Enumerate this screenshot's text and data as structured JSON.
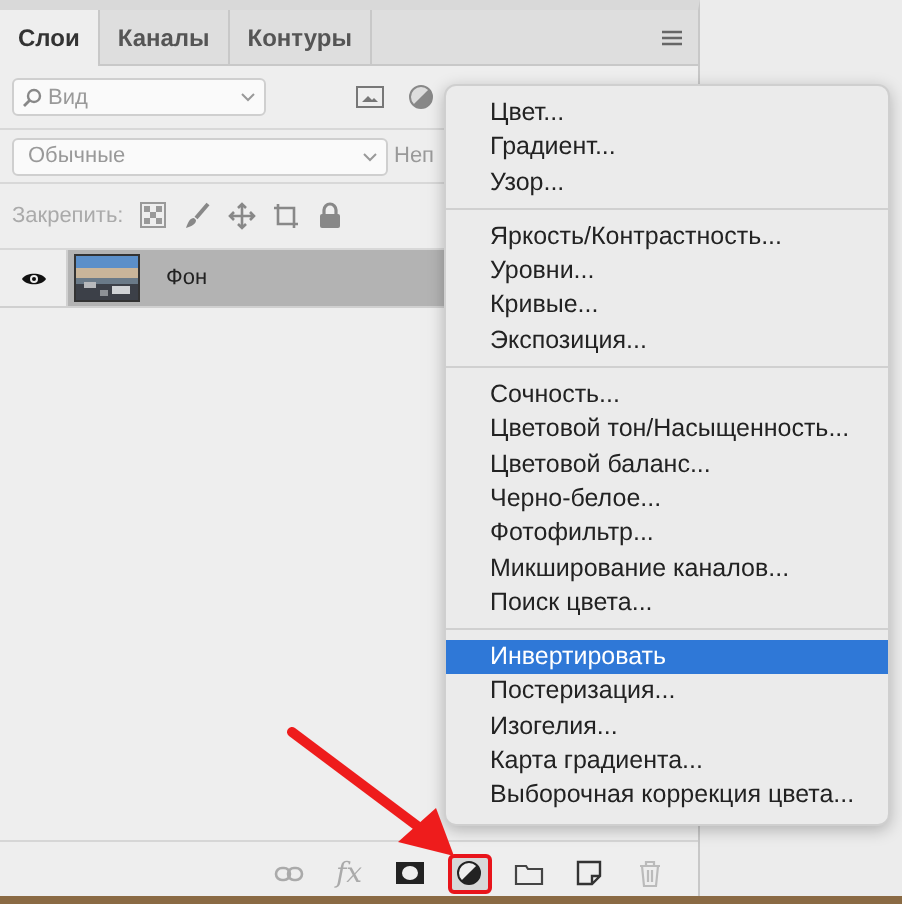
{
  "tabs": [
    {
      "label": "Слои",
      "selected": true
    },
    {
      "label": "Каналы",
      "selected": false
    },
    {
      "label": "Контуры",
      "selected": false
    }
  ],
  "filter": {
    "value": "Вид"
  },
  "blend_mode": {
    "value": "Обычные"
  },
  "opacity_label": "Неп",
  "lock_label": "Закрепить:",
  "layers": [
    {
      "name": "Фон",
      "visible": true,
      "selected": true
    }
  ],
  "menu": {
    "groups": [
      [
        {
          "label": "Цвет...",
          "selected": false
        },
        {
          "label": "Градиент...",
          "selected": false
        },
        {
          "label": "Узор...",
          "selected": false
        }
      ],
      [
        {
          "label": "Яркость/Контрастность...",
          "selected": false
        },
        {
          "label": "Уровни...",
          "selected": false
        },
        {
          "label": "Кривые...",
          "selected": false
        },
        {
          "label": "Экспозиция...",
          "selected": false
        }
      ],
      [
        {
          "label": "Сочность...",
          "selected": false
        },
        {
          "label": "Цветовой тон/Насыщенность...",
          "selected": false
        },
        {
          "label": "Цветовой баланс...",
          "selected": false
        },
        {
          "label": "Черно-белое...",
          "selected": false
        },
        {
          "label": "Фотофильтр...",
          "selected": false
        },
        {
          "label": "Микширование каналов...",
          "selected": false
        },
        {
          "label": "Поиск цвета...",
          "selected": false
        }
      ],
      [
        {
          "label": "Инвертировать",
          "selected": true
        },
        {
          "label": "Постеризация...",
          "selected": false
        },
        {
          "label": "Изогелия...",
          "selected": false
        },
        {
          "label": "Карта градиента...",
          "selected": false
        },
        {
          "label": "Выборочная коррекция цвета...",
          "selected": false
        }
      ]
    ]
  },
  "toolbar": [
    {
      "kind": "link",
      "highlighted": false
    },
    {
      "kind": "fx",
      "label": "fx",
      "highlighted": false
    },
    {
      "kind": "mask",
      "highlighted": false
    },
    {
      "kind": "adjustment",
      "highlighted": true
    },
    {
      "kind": "folder",
      "highlighted": false
    },
    {
      "kind": "new",
      "highlighted": false
    },
    {
      "kind": "trash",
      "highlighted": false
    }
  ]
}
